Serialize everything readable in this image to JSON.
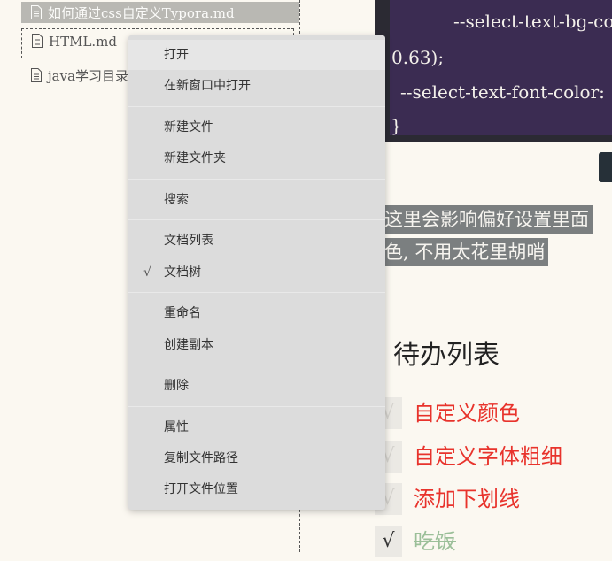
{
  "sidebar": {
    "items": [
      {
        "label": "如何通过css自定义Typora.md"
      },
      {
        "label": "HTML.md"
      },
      {
        "label": "java学习目录.md"
      }
    ]
  },
  "code": {
    "lines": [
      "--select-text-bg-col",
      "0.63);",
      "--select-text-font-color:",
      "}"
    ]
  },
  "paragraph": {
    "lines": [
      "这里会影响偏好设置里面",
      "色, 不用太花里胡哨"
    ]
  },
  "todo": {
    "heading": "待办列表",
    "items": [
      {
        "check": "√",
        "text": "自定义颜色",
        "done": false
      },
      {
        "check": "√",
        "text": "自定义字体粗细",
        "done": false
      },
      {
        "check": "√",
        "text": "添加下划线",
        "done": false
      },
      {
        "check": "√",
        "text": "吃饭",
        "done": true
      }
    ]
  },
  "context_menu": {
    "items": [
      {
        "label": "打开"
      },
      {
        "label": "在新窗口中打开"
      },
      {
        "label": "新建文件"
      },
      {
        "label": "新建文件夹"
      },
      {
        "label": "搜索"
      },
      {
        "label": "文档列表"
      },
      {
        "label": "文档树",
        "check": "√"
      },
      {
        "label": "重命名"
      },
      {
        "label": "创建副本"
      },
      {
        "label": "删除"
      },
      {
        "label": "属性"
      },
      {
        "label": "复制文件路径"
      },
      {
        "label": "打开文件位置"
      }
    ]
  },
  "colors": {
    "background": "#fbf8f1",
    "menu_bg": "#dcdcdc",
    "todo_text": "#e8332c",
    "todo_done": "#9bbf99",
    "code_bg": "#3b2c52",
    "highlight": "#7b7f80"
  },
  "icons": {
    "file": "document-icon"
  }
}
